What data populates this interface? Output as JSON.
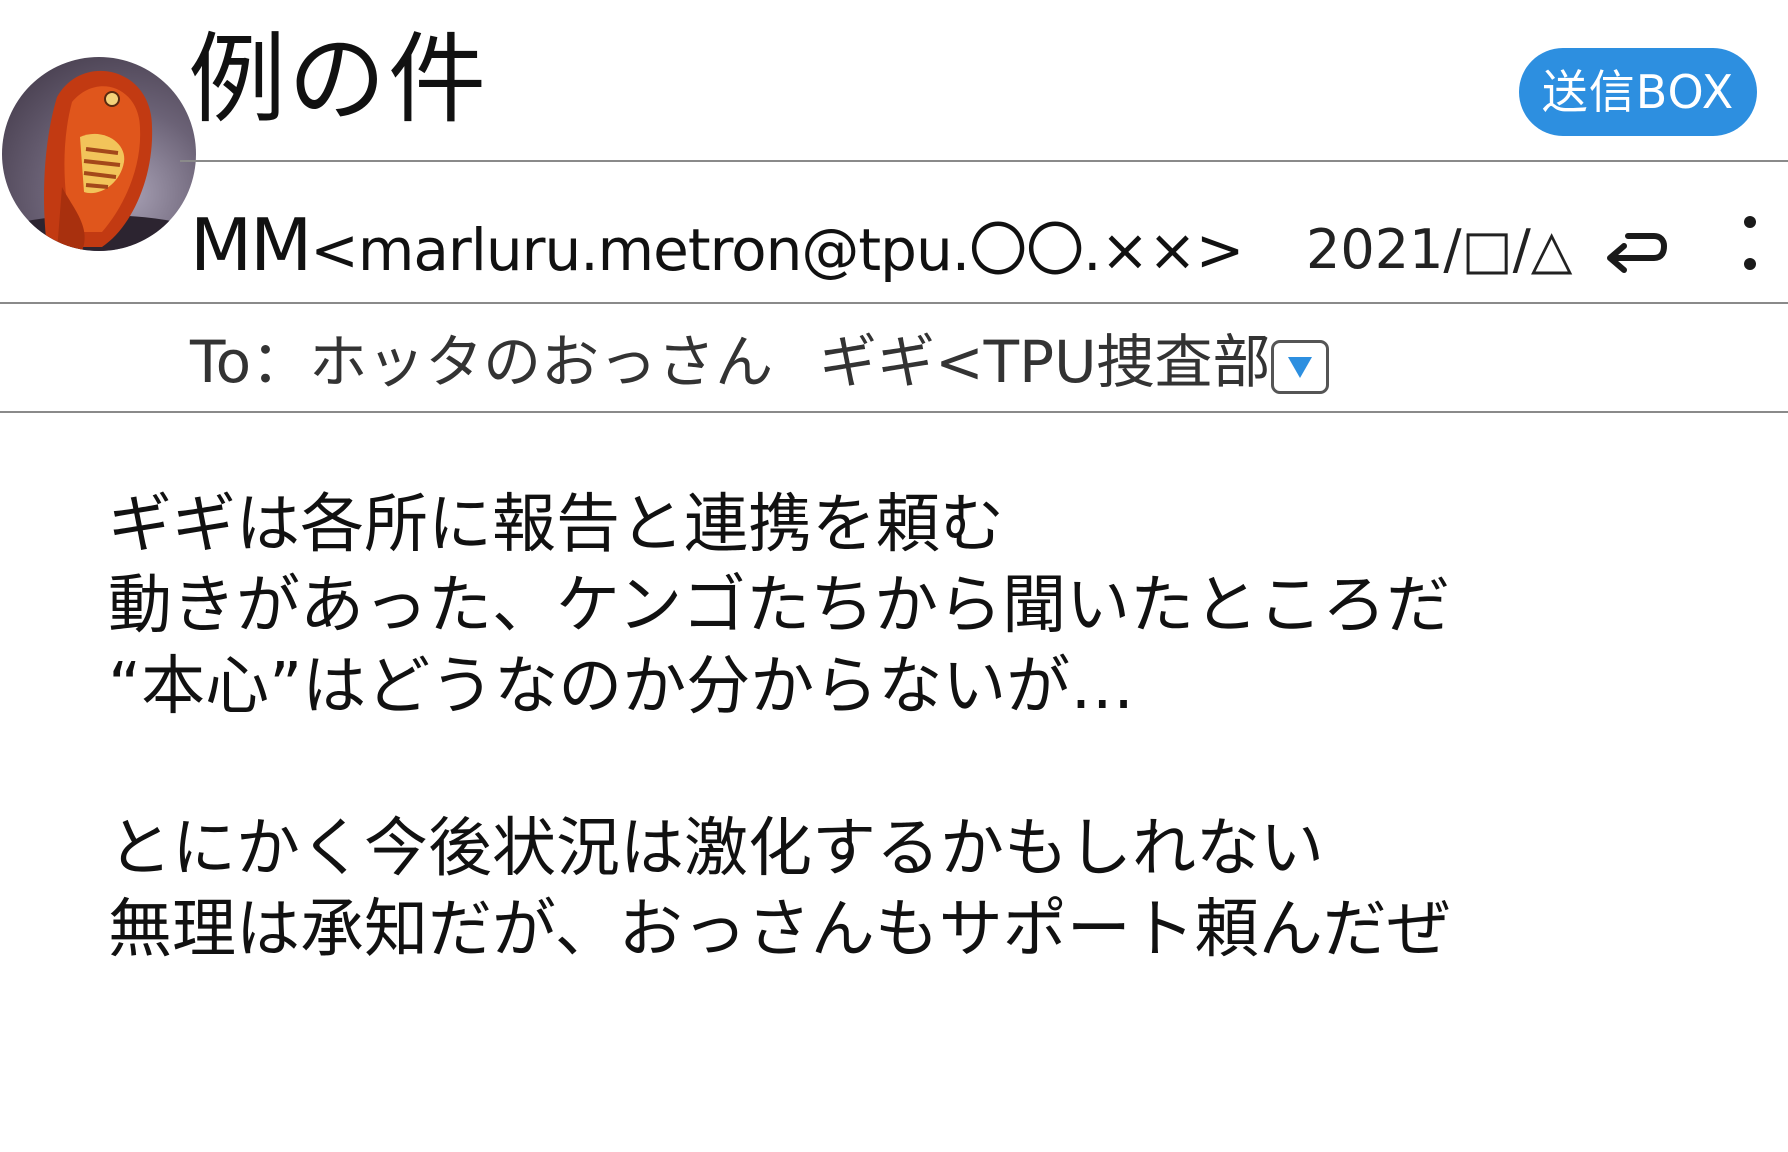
{
  "message": {
    "subject": "例の件",
    "folder_badge": "送信BOX",
    "sender_name": "MM",
    "sender_address": "<marluru.metron@tpu.〇〇.××>",
    "date": "2021/□/△",
    "recipients": {
      "prefix": "To：",
      "first": "ホッタのおっさん",
      "second": "ギギ<TPU捜査部>"
    },
    "body_lines": [
      "ギギは各所に報告と連携を頼む",
      "動きがあった、ケンゴたちから聞いたところだ",
      "“本心”はどうなのか分からないが…",
      "",
      "とにかく今後状況は激化するかもしれない",
      "無理は承知だが、おっさんもサポート頼んだぜ"
    ]
  },
  "icons": {
    "reply": "reply-arrow-icon",
    "more": "vertical-more-icon",
    "expand": "triangle-down-icon"
  },
  "colors": {
    "badge": "#2d8fe0",
    "expand_triangle": "#2d8fe0",
    "rule": "#8a8a8a"
  }
}
